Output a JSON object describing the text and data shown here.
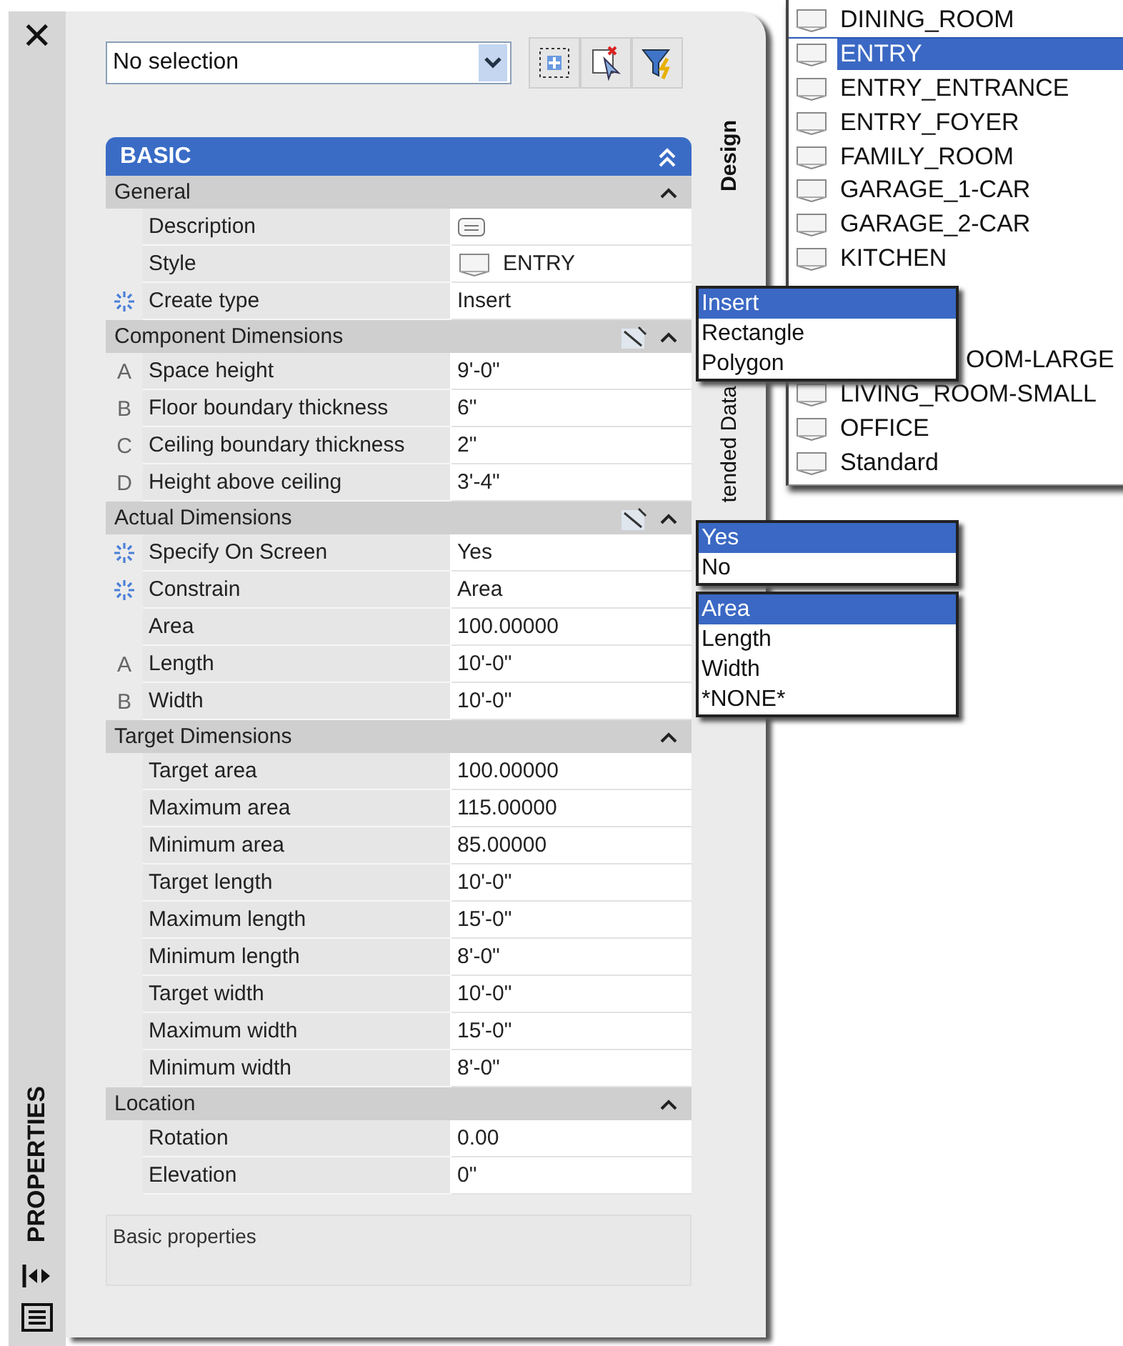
{
  "palette": {
    "close": "✕",
    "side_title": "PROPERTIES",
    "selection": "No selection",
    "tabs": [
      {
        "label": "Design",
        "selected": true
      },
      {
        "label": "tended Data",
        "selected": false
      }
    ],
    "groups": [
      {
        "title": "BASIC",
        "kind": "category",
        "expanded": true
      },
      {
        "title": "General",
        "kind": "group",
        "expanded": true,
        "tool": false,
        "rows": [
          {
            "name": "Description",
            "value": "",
            "kind": "note",
            "sparkle": false
          },
          {
            "name": "Style",
            "value": "ENTRY",
            "kind": "style",
            "sparkle": false
          },
          {
            "name": "Create type",
            "value": "Insert",
            "kind": "text",
            "sparkle": true
          }
        ]
      },
      {
        "title": "Component Dimensions",
        "kind": "group",
        "expanded": true,
        "tool": true,
        "rows": [
          {
            "letter": "A",
            "name": "Space height",
            "value": "9'-0\"",
            "kind": "text",
            "sparkle": false
          },
          {
            "letter": "B",
            "name": "Floor boundary thickness",
            "value": "6\"",
            "kind": "text",
            "sparkle": false
          },
          {
            "letter": "C",
            "name": "Ceiling boundary thickness",
            "value": "2\"",
            "kind": "text",
            "sparkle": false
          },
          {
            "letter": "D",
            "name": "Height above ceiling",
            "value": "3'-4\"",
            "kind": "text",
            "sparkle": false
          }
        ]
      },
      {
        "title": "Actual Dimensions",
        "kind": "group",
        "expanded": true,
        "tool": true,
        "rows": [
          {
            "name": "Specify On Screen",
            "value": "Yes",
            "kind": "text",
            "sparkle": true
          },
          {
            "name": "Constrain",
            "value": "Area",
            "kind": "text",
            "sparkle": true
          },
          {
            "name": "Area",
            "value": "100.00000",
            "kind": "text",
            "sparkle": false
          },
          {
            "letter": "A",
            "name": "Length",
            "value": "10'-0\"",
            "kind": "text",
            "sparkle": false
          },
          {
            "letter": "B",
            "name": "Width",
            "value": "10'-0\"",
            "kind": "text",
            "sparkle": false
          }
        ]
      },
      {
        "title": "Target Dimensions",
        "kind": "group",
        "expanded": true,
        "tool": false,
        "rows": [
          {
            "name": "Target area",
            "value": "100.00000",
            "kind": "text",
            "sparkle": false
          },
          {
            "name": "Maximum area",
            "value": "115.00000",
            "kind": "text",
            "sparkle": false
          },
          {
            "name": "Minimum area",
            "value": "85.00000",
            "kind": "text",
            "sparkle": false
          },
          {
            "name": "Target length",
            "value": "10'-0\"",
            "kind": "text",
            "sparkle": false
          },
          {
            "name": "Maximum length",
            "value": "15'-0\"",
            "kind": "text",
            "sparkle": false
          },
          {
            "name": "Minimum length",
            "value": "8'-0\"",
            "kind": "text",
            "sparkle": false
          },
          {
            "name": "Target width",
            "value": "10'-0\"",
            "kind": "text",
            "sparkle": false
          },
          {
            "name": "Maximum width",
            "value": "15'-0\"",
            "kind": "text",
            "sparkle": false
          },
          {
            "name": "Minimum width",
            "value": "8'-0\"",
            "kind": "text",
            "sparkle": false
          }
        ]
      },
      {
        "title": "Location",
        "kind": "group",
        "expanded": true,
        "tool": false,
        "rows": [
          {
            "name": "Rotation",
            "value": "0.00",
            "kind": "text",
            "sparkle": false
          },
          {
            "name": "Elevation",
            "value": "0\"",
            "kind": "text",
            "sparkle": false
          }
        ]
      }
    ],
    "help": "Basic properties"
  },
  "style_list": [
    {
      "label": "DINING_ROOM",
      "kind": "full",
      "selected": false
    },
    {
      "label": "ENTRY",
      "kind": "full",
      "selected": true
    },
    {
      "label": "ENTRY_ENTRANCE",
      "kind": "full",
      "selected": false
    },
    {
      "label": "ENTRY_FOYER",
      "kind": "full",
      "selected": false
    },
    {
      "label": "FAMILY_ROOM",
      "kind": "full",
      "selected": false
    },
    {
      "label": "GARAGE_1-CAR",
      "kind": "full",
      "selected": false
    },
    {
      "label": "GARAGE_2-CAR",
      "kind": "full",
      "selected": false
    },
    {
      "label": "KITCHEN",
      "kind": "full",
      "selected": false
    },
    {
      "kind": "covered",
      "selected": false
    },
    {
      "kind": "covered",
      "selected": false
    },
    {
      "label": "OOM-LARGE",
      "kind": "partial",
      "selected": false
    },
    {
      "label": "LIVING_ROOM-SMALL",
      "kind": "full",
      "selected": false
    },
    {
      "label": "OFFICE",
      "kind": "full",
      "selected": false
    },
    {
      "label": "Standard",
      "kind": "full",
      "selected": false
    }
  ],
  "menus": [
    {
      "kind": "create",
      "items": [
        {
          "label": "Insert",
          "selected": true
        },
        {
          "label": "Rectangle",
          "selected": false
        },
        {
          "label": "Polygon",
          "selected": false
        }
      ]
    },
    {
      "kind": "screen",
      "items": [
        {
          "label": "Yes",
          "selected": true
        },
        {
          "label": "No",
          "selected": false
        }
      ]
    },
    {
      "kind": "constrain",
      "items": [
        {
          "label": "Area",
          "selected": true
        },
        {
          "label": "Length",
          "selected": false
        },
        {
          "label": "Width",
          "selected": false
        },
        {
          "label": "*NONE*",
          "selected": false
        }
      ]
    }
  ]
}
